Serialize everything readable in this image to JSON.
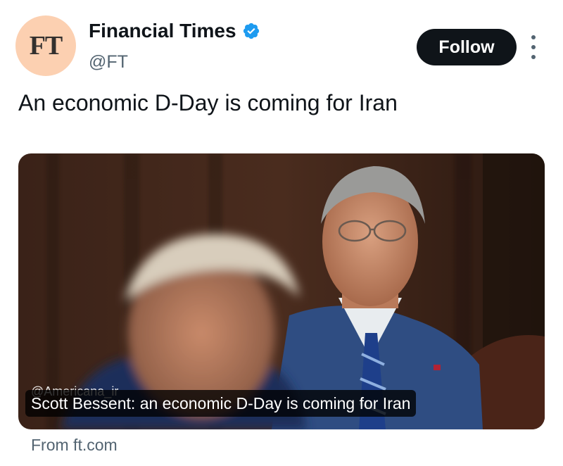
{
  "account": {
    "avatar_text": "FT",
    "display_name": "Financial Times",
    "handle": "@FT",
    "verified_icon": "verified-badge-icon"
  },
  "actions": {
    "follow_label": "Follow",
    "more_icon": "more-vertical-icon"
  },
  "tweet": {
    "text": "An economic D-Day is coming for Iran"
  },
  "card": {
    "watermark": "@Americana_ir",
    "caption": "Scott Bessent: an economic D-Day is coming for Iran",
    "source": "From ft.com"
  },
  "colors": {
    "avatar_bg": "#fcd0b1",
    "verified": "#1d9bf0",
    "follow_bg": "#0f1419",
    "secondary_text": "#536471"
  }
}
